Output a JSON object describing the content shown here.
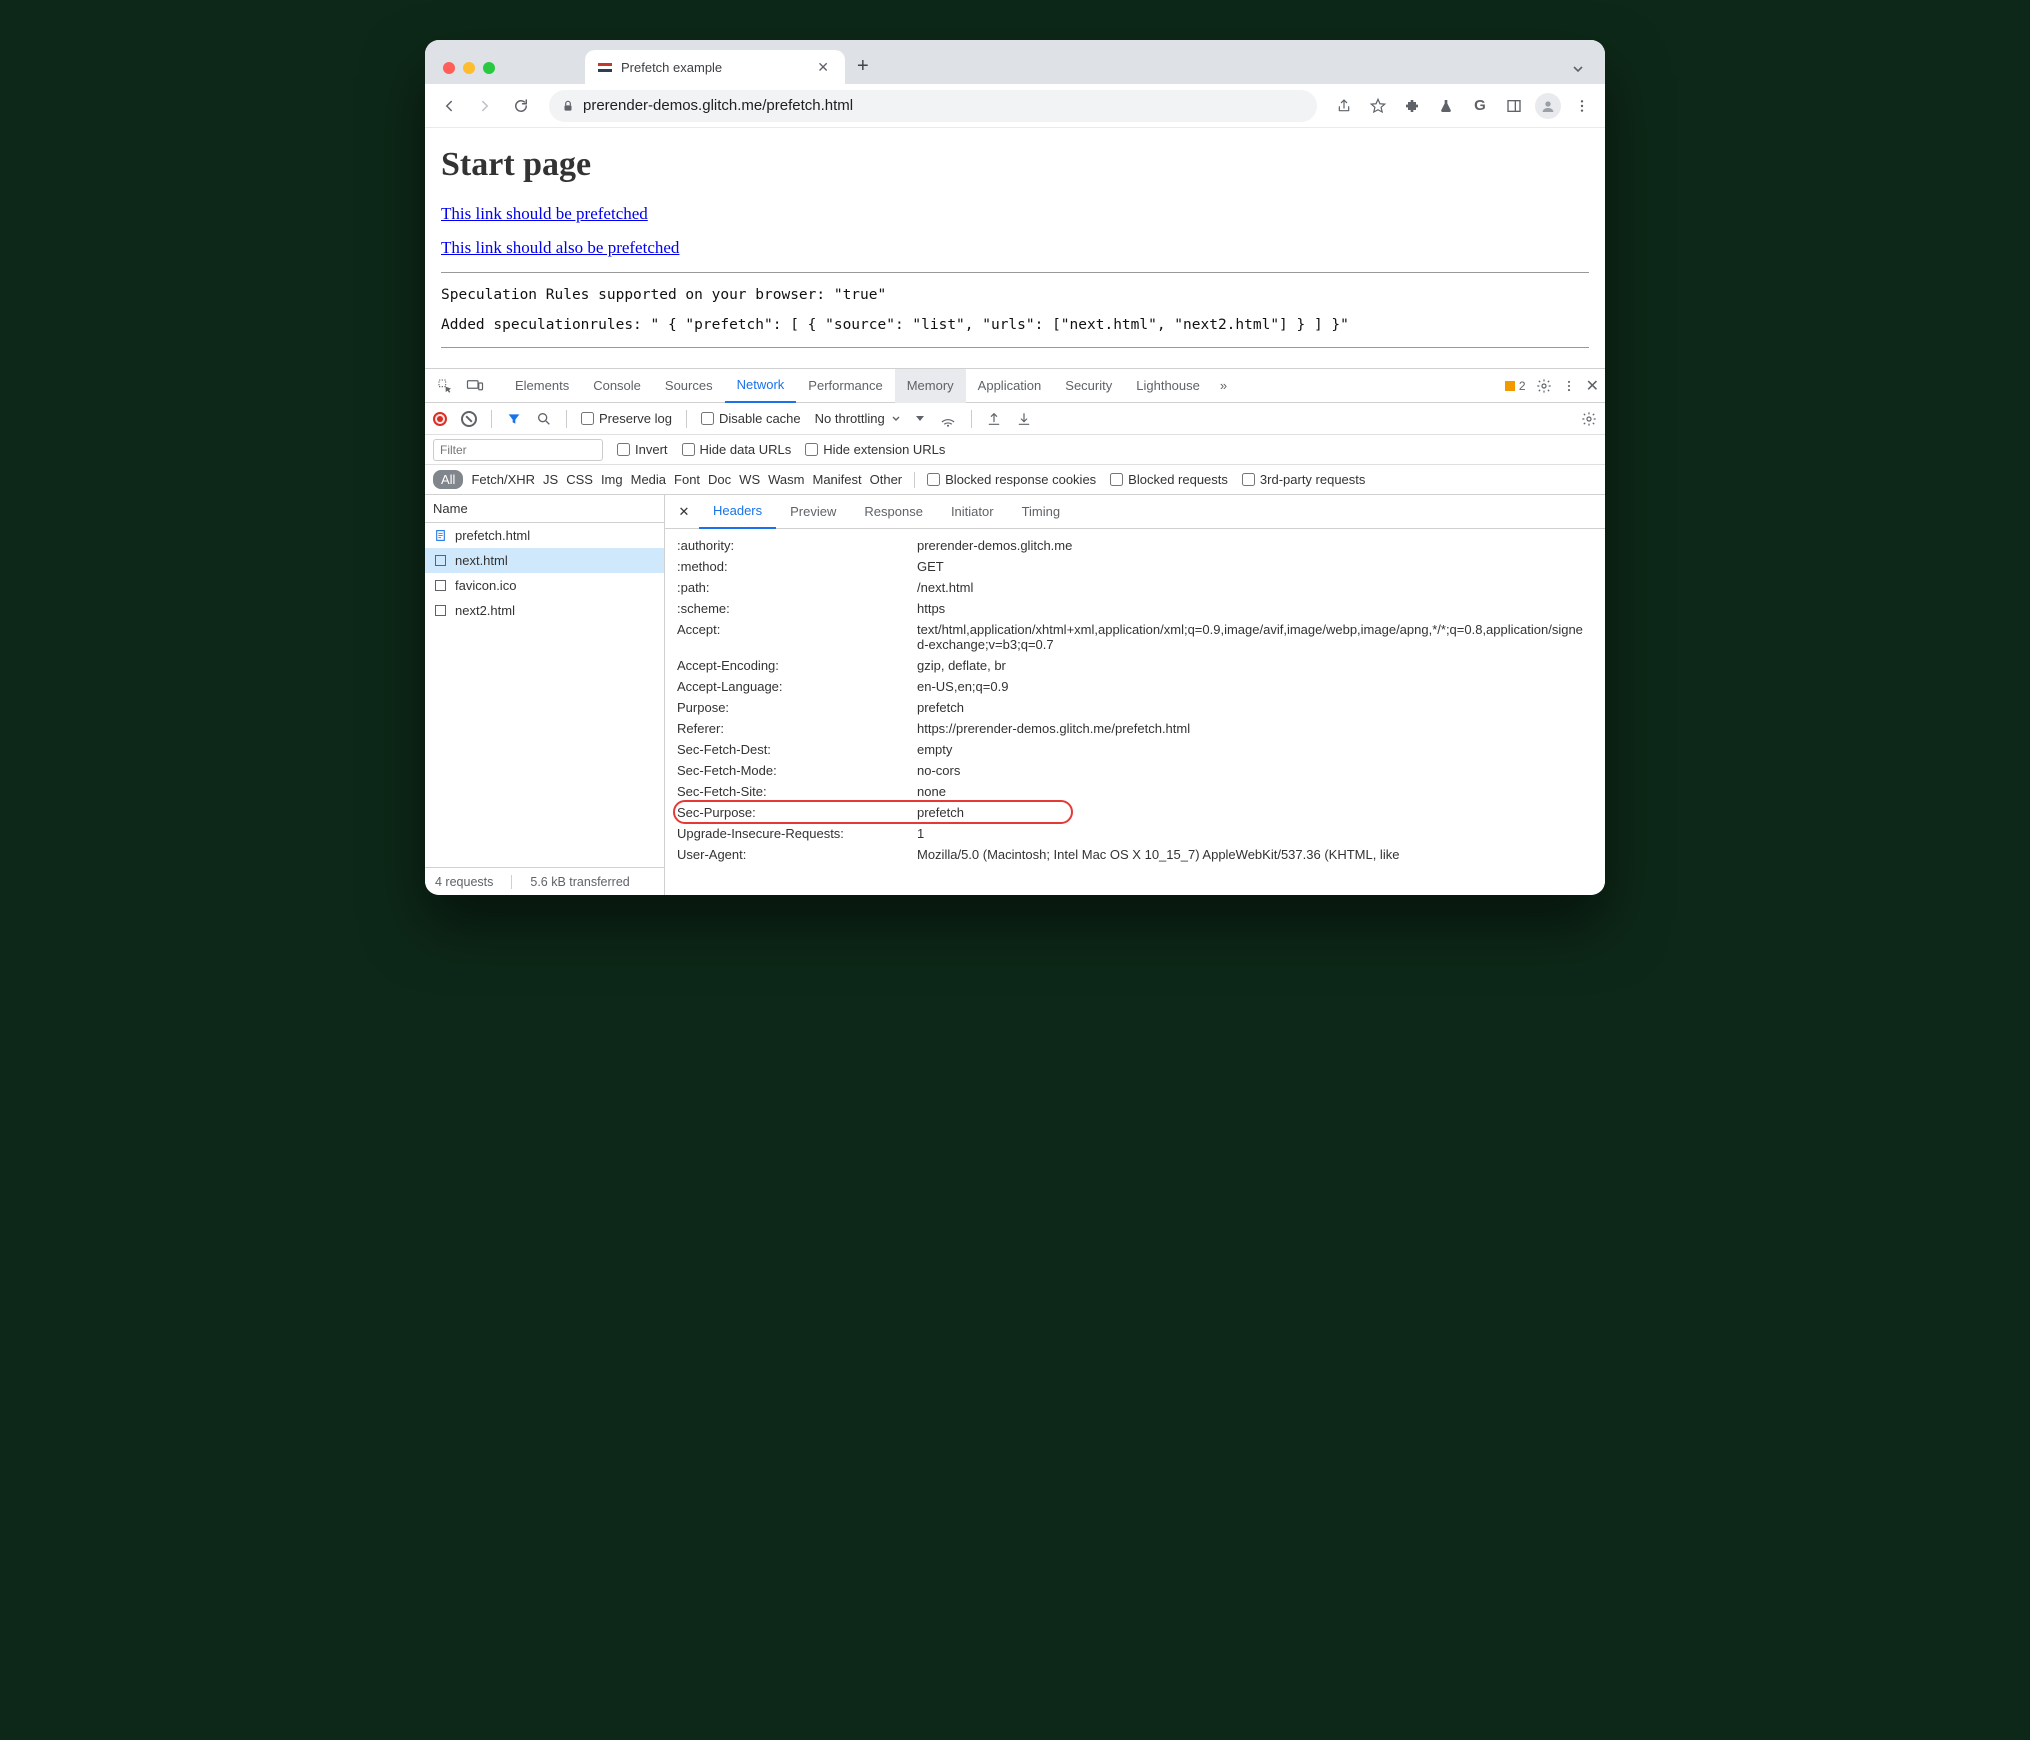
{
  "browser": {
    "tab_title": "Prefetch example",
    "url": "prerender-demos.glitch.me/prefetch.html",
    "new_tab_label": "+",
    "chevron_label": "v"
  },
  "page": {
    "heading": "Start page",
    "link1": "This link should be prefetched",
    "link2": "This link should also be prefetched",
    "mono1": "Speculation Rules supported on your browser: \"true\"",
    "mono2": "Added speculationrules: \" { \"prefetch\": [ { \"source\": \"list\", \"urls\": [\"next.html\", \"next2.html\"] } ] }\""
  },
  "devtools": {
    "panels": [
      "Elements",
      "Console",
      "Sources",
      "Network",
      "Performance",
      "Memory",
      "Application",
      "Security",
      "Lighthouse"
    ],
    "active_panel": "Network",
    "highlight_panel": "Memory",
    "more_glyph": "»",
    "warn_count": "2",
    "toolbar2": {
      "preserve_log": "Preserve log",
      "disable_cache": "Disable cache",
      "throttling": "No throttling"
    },
    "toolbar3": {
      "filter_placeholder": "Filter",
      "invert": "Invert",
      "hide_data": "Hide data URLs",
      "hide_ext": "Hide extension URLs"
    },
    "typefilters": [
      "All",
      "Fetch/XHR",
      "JS",
      "CSS",
      "Img",
      "Media",
      "Font",
      "Doc",
      "WS",
      "Wasm",
      "Manifest",
      "Other"
    ],
    "extra_filters": [
      "Blocked response cookies",
      "Blocked requests",
      "3rd-party requests"
    ],
    "name_col": "Name",
    "requests": [
      {
        "name": "prefetch.html",
        "icon": "doc",
        "sel": false
      },
      {
        "name": "next.html",
        "icon": "box",
        "sel": true
      },
      {
        "name": "favicon.ico",
        "icon": "box",
        "sel": false
      },
      {
        "name": "next2.html",
        "icon": "box",
        "sel": false
      }
    ],
    "detail_tabs": [
      "Headers",
      "Preview",
      "Response",
      "Initiator",
      "Timing"
    ],
    "active_detail_tab": "Headers",
    "headers": [
      {
        "k": ":authority:",
        "v": "prerender-demos.glitch.me"
      },
      {
        "k": ":method:",
        "v": "GET"
      },
      {
        "k": ":path:",
        "v": "/next.html"
      },
      {
        "k": ":scheme:",
        "v": "https"
      },
      {
        "k": "Accept:",
        "v": "text/html,application/xhtml+xml,application/xml;q=0.9,image/avif,image/webp,image/apng,*/*;q=0.8,application/signed-exchange;v=b3;q=0.7"
      },
      {
        "k": "Accept-Encoding:",
        "v": "gzip, deflate, br"
      },
      {
        "k": "Accept-Language:",
        "v": "en-US,en;q=0.9"
      },
      {
        "k": "Purpose:",
        "v": "prefetch"
      },
      {
        "k": "Referer:",
        "v": "https://prerender-demos.glitch.me/prefetch.html"
      },
      {
        "k": "Sec-Fetch-Dest:",
        "v": "empty"
      },
      {
        "k": "Sec-Fetch-Mode:",
        "v": "no-cors"
      },
      {
        "k": "Sec-Fetch-Site:",
        "v": "none"
      },
      {
        "k": "Sec-Purpose:",
        "v": "prefetch",
        "highlight": true
      },
      {
        "k": "Upgrade-Insecure-Requests:",
        "v": "1"
      },
      {
        "k": "User-Agent:",
        "v": "Mozilla/5.0 (Macintosh; Intel Mac OS X 10_15_7) AppleWebKit/537.36 (KHTML, like"
      }
    ],
    "footer": {
      "requests": "4 requests",
      "transferred": "5.6 kB transferred"
    }
  }
}
